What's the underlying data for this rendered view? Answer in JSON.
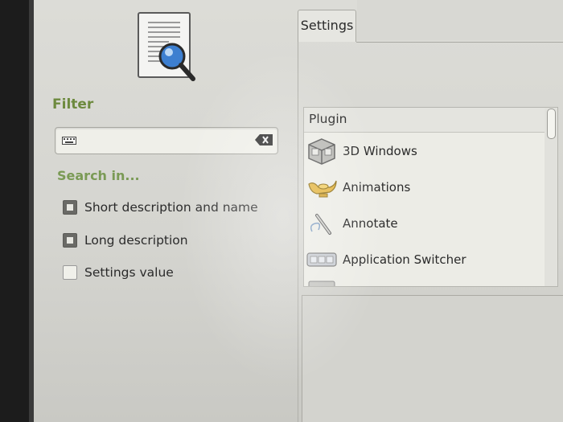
{
  "top_fragment": "...",
  "filter": {
    "label": "Filter",
    "value": "",
    "placeholder": ""
  },
  "search_in": {
    "label": "Search in...",
    "options": [
      {
        "label": "Short description and name",
        "checked": true
      },
      {
        "label": "Long description",
        "checked": true
      },
      {
        "label": "Settings value",
        "checked": false
      }
    ]
  },
  "tabs": [
    {
      "label": "Settings",
      "active": true
    }
  ],
  "plugin_list": {
    "header": "Plugin",
    "items": [
      {
        "label": "3D Windows",
        "icon": "cube-icon"
      },
      {
        "label": "Animations",
        "icon": "genie-lamp-icon"
      },
      {
        "label": "Annotate",
        "icon": "pencil-icon"
      },
      {
        "label": "Application Switcher",
        "icon": "window-switcher-icon"
      }
    ]
  },
  "colors": {
    "section_label": "#6d8a3e",
    "background": "#dcdcd7"
  }
}
